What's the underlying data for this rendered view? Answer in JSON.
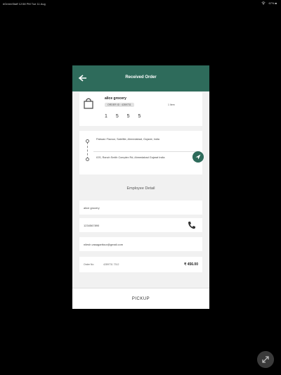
{
  "status_bar": {
    "left": "#GreenStaff  12:58 PM  Tue 11 Aug",
    "right": "67% ■"
  },
  "dialog": {
    "title": "Received Order",
    "shop": {
      "name": "alice grocery",
      "order_chip": "ORDER ID : 4289731",
      "qty": "1 Item",
      "otp": "1 5 5 5"
    },
    "addresses": {
      "pickup": "Pakwan Flavour, Satellite, Ahmedabad, Gujarat, India",
      "drop": "IOS, Ranch Smith Complex Rd, Ahmedabad Gujarat India"
    },
    "section_title": "Employee Detail",
    "employee": {
      "name": "alice grocery",
      "phone": "1234567890",
      "email": "nilesh.vasagarttour@gmail.com"
    },
    "order": {
      "label": "Order No",
      "id": "4289731 7312",
      "amount": "₹ 456.00"
    },
    "pickup_label": "PICKUP"
  },
  "colors": {
    "header": "#2e6b5b",
    "background": "#000000",
    "panel": "#f1f1f1"
  }
}
